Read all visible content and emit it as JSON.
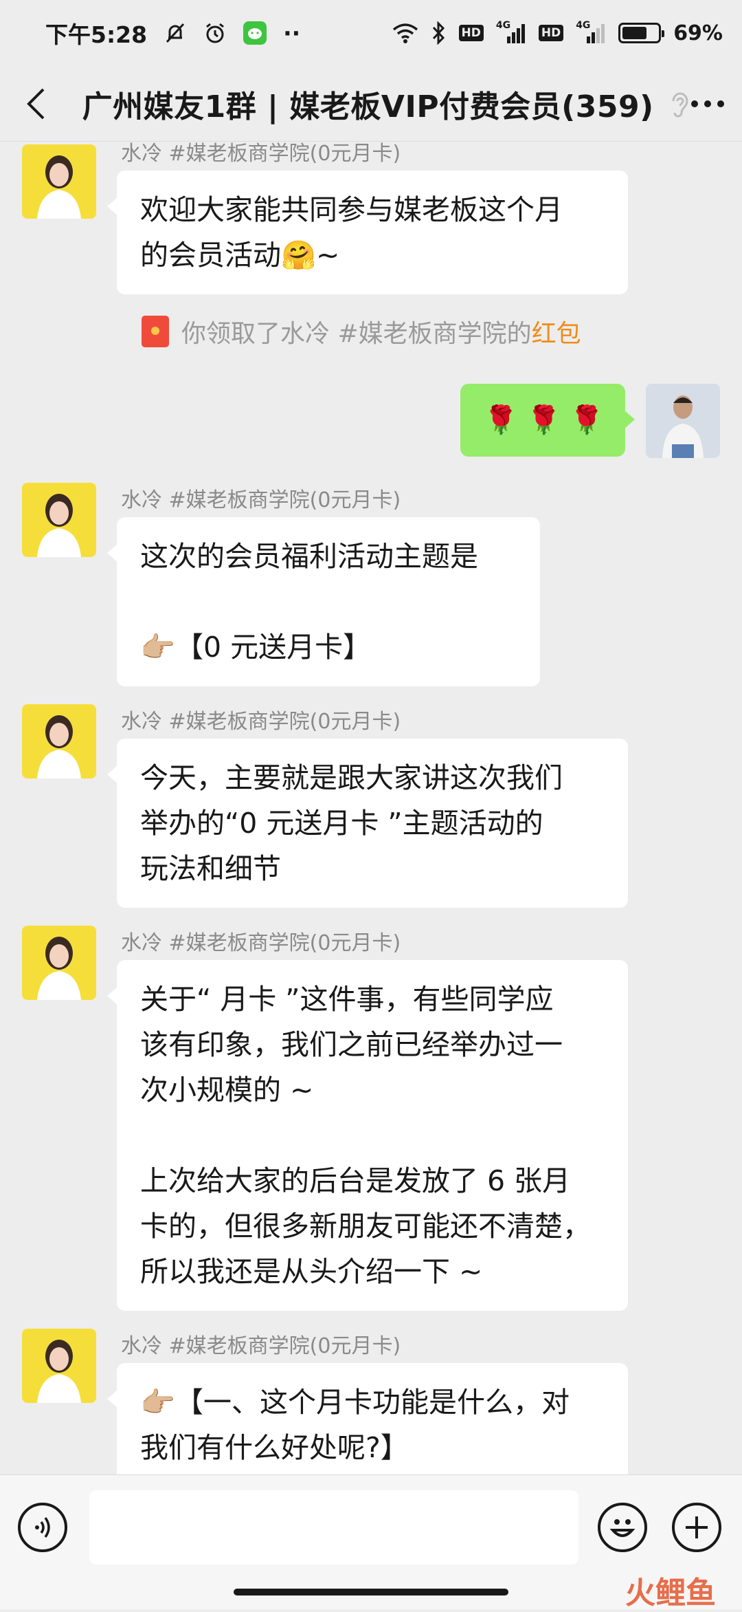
{
  "status_bar": {
    "time": "下午5:28",
    "dots": "··",
    "hd1": "HD",
    "net1": "4G",
    "hd2": "HD",
    "net2": "4G",
    "battery_pct": "69%",
    "battery_level": 0.69,
    "icons": [
      "mute-bell-icon",
      "alarm-icon",
      "wechat-notification-icon",
      "wifi-icon",
      "bluetooth-icon",
      "signal-icon",
      "battery-icon"
    ]
  },
  "header": {
    "title": "广州媒友1群 | 媒老板VIP付费会员(359)",
    "icons": [
      "back-chevron-icon",
      "ear-icon",
      "more-dots-icon"
    ]
  },
  "messages": [
    {
      "sender": "水冷 #媒老板商学院(0元月卡)",
      "lines": [
        "欢迎大家能共同参与媒老板这个月",
        "的会员活动🤗~"
      ]
    },
    {
      "system": "你领取了水冷 #媒老板商学院的",
      "system_link": "红包"
    },
    {
      "self": true,
      "text": "🌹 🌹 🌹"
    },
    {
      "sender": "水冷 #媒老板商学院(0元月卡)",
      "lines": [
        "这次的会员福利活动主题是",
        "",
        "👉🏼【0 元送月卡】"
      ]
    },
    {
      "sender": "水冷 #媒老板商学院(0元月卡)",
      "lines": [
        "今天，主要就是跟大家讲这次我们",
        "举办的“0 元送月卡 ”主题活动的",
        "玩法和细节"
      ]
    },
    {
      "sender": "水冷 #媒老板商学院(0元月卡)",
      "lines": [
        "关于“ 月卡 ”这件事，有些同学应",
        "该有印象，我们之前已经举办过一",
        "次小规模的 ~",
        "",
        "上次给大家的后台是发放了 6 张月",
        "卡的，但很多新朋友可能还不清楚，",
        "所以我还是从头介绍一下 ~"
      ]
    },
    {
      "sender": "水冷 #媒老板商学院(0元月卡)",
      "lines": [
        "👉🏼【一、这个月卡功能是什么，对",
        "我们有什么好处呢?】"
      ]
    }
  ],
  "input_bar": {
    "placeholder": "",
    "icons": [
      "voice-icon",
      "emoji-icon",
      "plus-icon"
    ]
  },
  "watermark": "火鲤鱼",
  "colors": {
    "background": "#ededed",
    "bubble_self": "#95ec69",
    "bubble_other": "#ffffff",
    "link": "#f08c1c"
  }
}
